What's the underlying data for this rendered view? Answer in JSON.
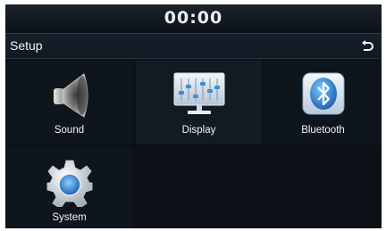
{
  "status_bar": {
    "time": "00:00"
  },
  "header": {
    "title": "Setup",
    "back_icon": "back-arrow-icon"
  },
  "menu": {
    "items": [
      {
        "label": "Sound",
        "icon": "speaker-icon"
      },
      {
        "label": "Display",
        "icon": "display-equalizer-icon"
      },
      {
        "label": "Bluetooth",
        "icon": "bluetooth-icon"
      },
      {
        "label": "System",
        "icon": "gear-icon"
      }
    ]
  },
  "colors": {
    "background": "#0c1118",
    "text": "#f2f4f6",
    "accent": "#4aa0e6"
  }
}
